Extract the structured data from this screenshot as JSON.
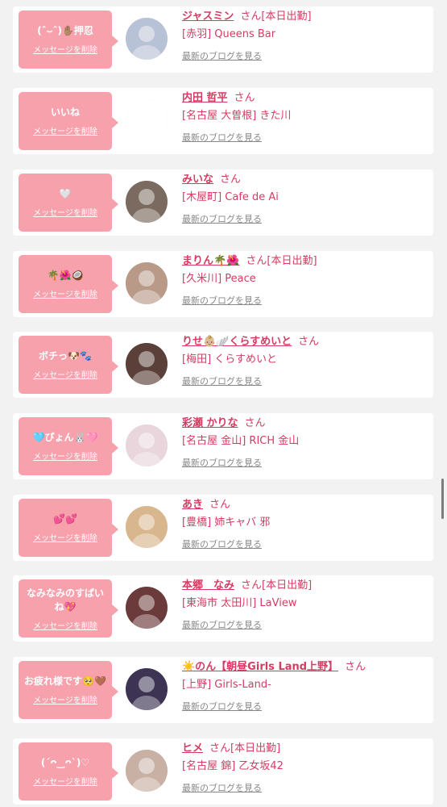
{
  "ui": {
    "delete_label": "メッセージを削除",
    "blog_label": "最新のブログを見る",
    "honorific": "さん"
  },
  "items": [
    {
      "message": "(ˆ⌣ˆ)✋🏽押忍",
      "name": "ジャスミン",
      "status": "[本日出勤]",
      "shop": "[赤羽] Queens Bar",
      "avatar_color": "#b8c2d6"
    },
    {
      "message": "いいね",
      "name": "内田 哲平",
      "status": "",
      "shop": "[名古屋 大曽根] きた川",
      "avatar_color": "#ffffff"
    },
    {
      "message": "🤍",
      "name": "みいな",
      "status": "",
      "shop": "[木屋町] Cafe de Ai",
      "avatar_color": "#7a6a5f"
    },
    {
      "message": "🌴🌺🥥",
      "name": "まりん🌴🌺",
      "status": "[本日出勤]",
      "shop": "[久米川] Peace",
      "avatar_color": "#b99a88"
    },
    {
      "message": "ボチっ🐶🐾",
      "name": "りせ👶🏼🪽くらすめいと",
      "status": "",
      "shop": "[梅田] くらすめいと",
      "avatar_color": "#5a4038"
    },
    {
      "message": "🩵ぴょん🐰🩷",
      "name": "彩瀬 かりな",
      "status": "",
      "shop": "[名古屋 金山] RICH 金山",
      "avatar_color": "#e9d6dc"
    },
    {
      "message": "💕💕",
      "name": "あき",
      "status": "",
      "shop": "[豊橋] 姉キャバ 邪",
      "avatar_color": "#d9b78e"
    },
    {
      "message": "なみなみのすぱいね💖",
      "name": "本郷　なみ",
      "status": "[本日出勤]",
      "shop": "[東海市 太田川] LaView",
      "avatar_color": "#6b3a3a"
    },
    {
      "message": "お疲れ様です🥺🤎",
      "name": "☀️のん【朝昼Girls Land上野】",
      "status": "",
      "shop": "[上野] Girls-Land-",
      "avatar_color": "#3d3352"
    },
    {
      "message": "(´ᴖ‿ᴖ`)♡",
      "name": "ヒメ",
      "status": "[本日出勤]",
      "shop": "[名古屋 錦] 乙女坂42",
      "avatar_color": "#c9b0a4"
    }
  ]
}
